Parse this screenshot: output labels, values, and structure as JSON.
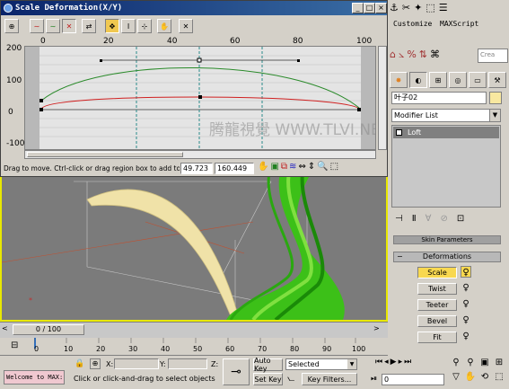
{
  "dialog": {
    "title": "Scale Deformation(X/Y)",
    "title_buttons": [
      "_",
      "□",
      "×"
    ],
    "toolbar_icons": [
      "make-symmetrical-icon",
      "display-x-icon",
      "display-y-icon",
      "display-xy-icon",
      "swap-curves-icon",
      "move-control-point-icon",
      "scale-control-point-icon",
      "insert-corner-point-icon",
      "delete-control-point-icon",
      "reset-curve-icon"
    ],
    "ruler_ticks": [
      "0",
      "20",
      "40",
      "60",
      "80",
      "100"
    ],
    "y_ticks": [
      "200",
      "100",
      "0",
      "-100"
    ],
    "status_text": "Drag to move. Ctrl-click or drag region box to add to s",
    "field_x": "49.723",
    "field_y": "160.449",
    "bottom_icons": [
      "pan-icon",
      "zoom-extents-icon",
      "zoom-horizontal-extents-icon",
      "zoom-vertical-extents-icon",
      "zoom-horizontal-icon",
      "zoom-vertical-icon",
      "zoom-icon",
      "zoom-region-icon"
    ],
    "watermark": "腾龍視覺 WWW.TLVI.NET"
  },
  "command_panel": {
    "top_buttons": [
      "Customize",
      "MAXScript"
    ],
    "tabs": [
      "create-icon",
      "modify-icon",
      "hierarchy-icon",
      "motion-icon",
      "display-icon",
      "utilities-icon"
    ],
    "object_name": "叶子02",
    "modifier_list": "Modifier List",
    "stack_item": "Loft",
    "rollout_skin": "Skin Parameters",
    "rollout_deform": "Deformations",
    "deform_buttons": [
      "Scale",
      "Twist",
      "Teeter",
      "Bevel",
      "Fit"
    ]
  },
  "timeline": {
    "frame_display": "0 / 100",
    "ticks": [
      "0",
      "10",
      "20",
      "30",
      "40",
      "50",
      "60",
      "70",
      "80",
      "90",
      "100"
    ]
  },
  "bottom_bar": {
    "welcome": "Welcome to MAX:",
    "x_label": "X:",
    "y_label": "Y:",
    "z_label": "Z:",
    "prompt": "Click or click-and-drag to select objects",
    "auto_key": "Auto Key",
    "set_key": "Set Key",
    "selected": "Selected",
    "key_filters": "Key Filters...",
    "frame_field": "0"
  },
  "colors": {
    "green_curve": "#2a8a2a",
    "red_curve": "#d02020",
    "viewport_border": "#e8e800"
  }
}
